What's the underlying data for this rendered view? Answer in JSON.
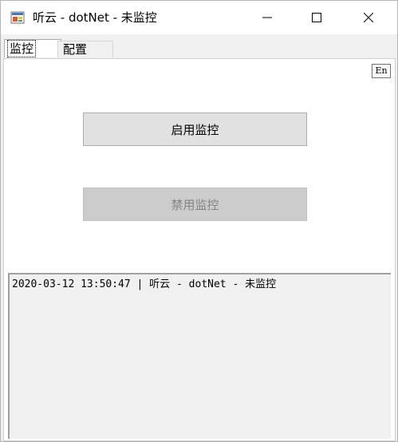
{
  "window": {
    "title": "听云 - dotNet - 未监控",
    "icon": "app-icon",
    "controls": [
      "minimize-icon",
      "maximize-icon",
      "close-icon"
    ]
  },
  "tabs": [
    {
      "label": "监控",
      "selected": true
    },
    {
      "label": "配置",
      "selected": false
    }
  ],
  "monitor": {
    "language_button": "En",
    "enable_button": "启用监控",
    "disable_button": "禁用监控",
    "log_lines": [
      "2020-03-12 13:50:47 | 听云 - dotNet - 未监控"
    ]
  }
}
